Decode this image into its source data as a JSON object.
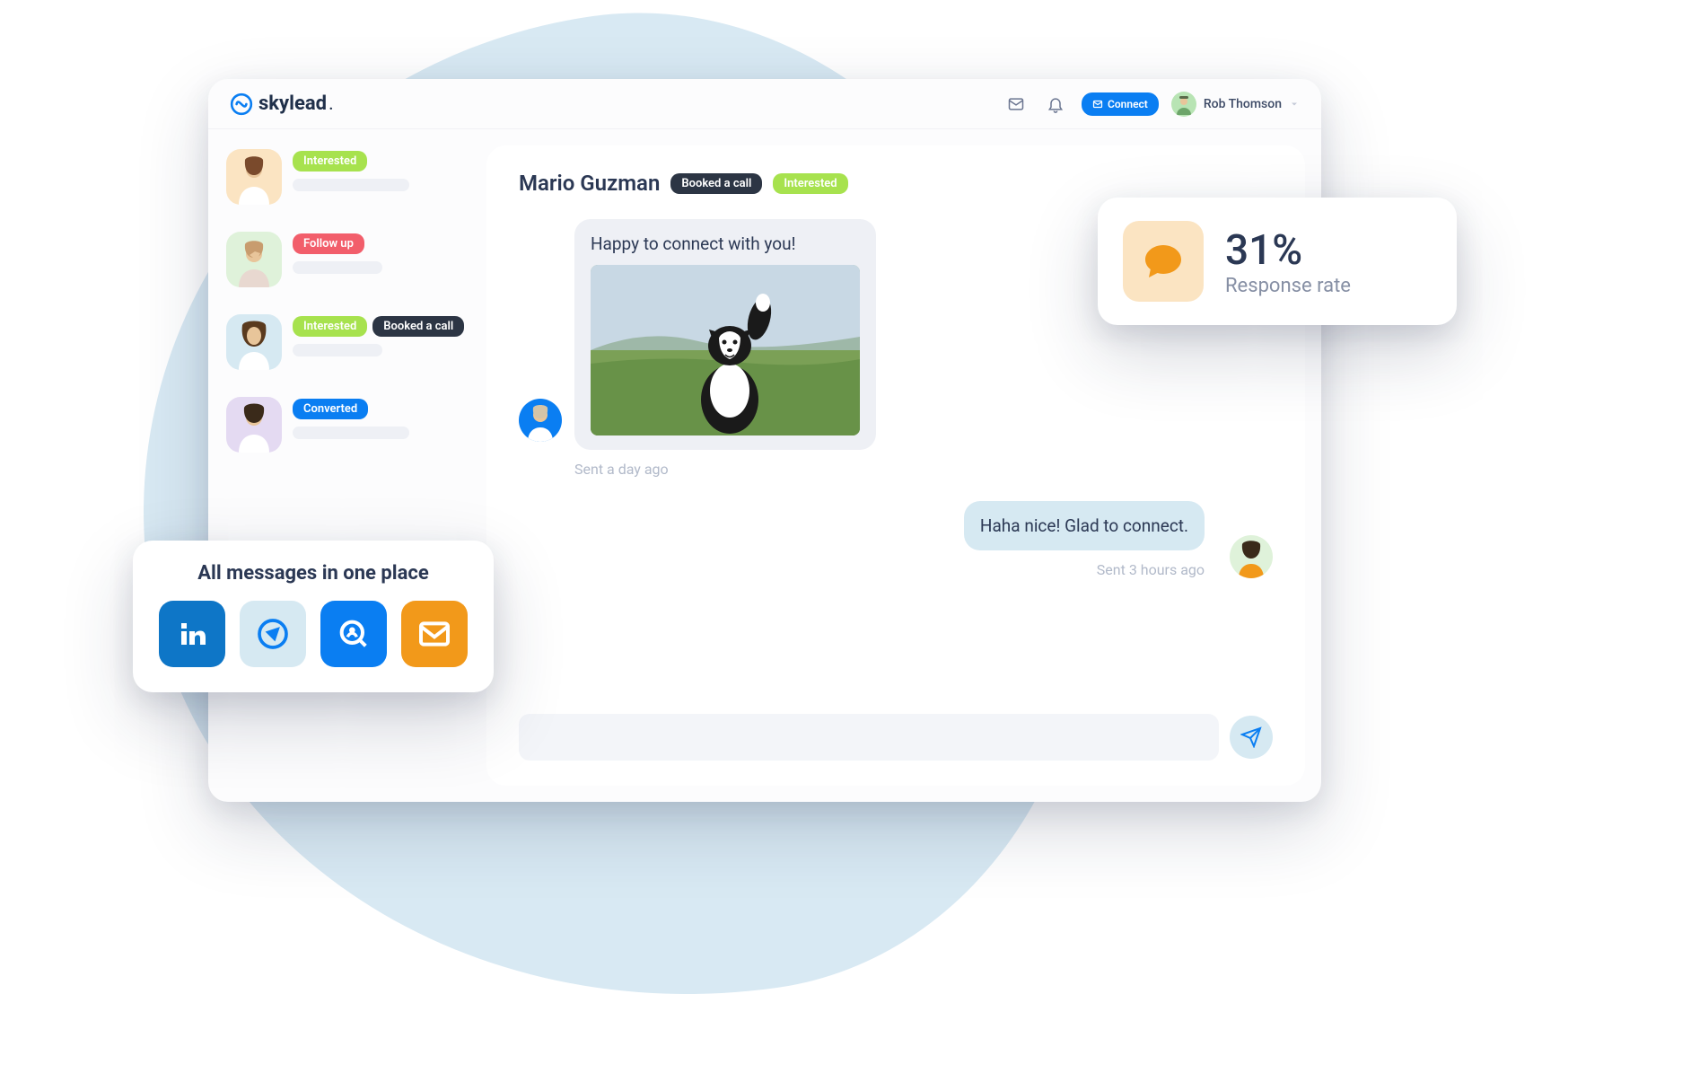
{
  "brand": "skylead",
  "header": {
    "connect_label": "Connect",
    "user_name": "Rob Thomson"
  },
  "sidebar": {
    "contacts": [
      {
        "avatar_bg": "#fbe4c2",
        "tags": [
          {
            "label": "Interested",
            "style": "green"
          }
        ]
      },
      {
        "avatar_bg": "#dff2da",
        "tags": [
          {
            "label": "Follow up",
            "style": "red"
          }
        ]
      },
      {
        "avatar_bg": "#d6e9f2",
        "tags": [
          {
            "label": "Interested",
            "style": "green"
          },
          {
            "label": "Booked a call",
            "style": "dark"
          }
        ]
      },
      {
        "avatar_bg": "#e4daf2",
        "tags": [
          {
            "label": "Converted",
            "style": "blue"
          }
        ]
      }
    ]
  },
  "chat": {
    "title": "Mario Guzman",
    "tags": [
      {
        "label": "Booked a call",
        "style": "dark"
      },
      {
        "label": "Interested",
        "style": "green"
      }
    ],
    "messages": [
      {
        "side": "left",
        "text": "Happy to connect with you!",
        "time": "Sent a day ago"
      },
      {
        "side": "right",
        "text": "Haha nice! Glad to connect.",
        "time": "Sent 3 hours ago"
      }
    ],
    "composer_placeholder": ""
  },
  "stat_card": {
    "value": "31%",
    "label": "Response rate"
  },
  "messages_card": {
    "title": "All messages in one place"
  }
}
